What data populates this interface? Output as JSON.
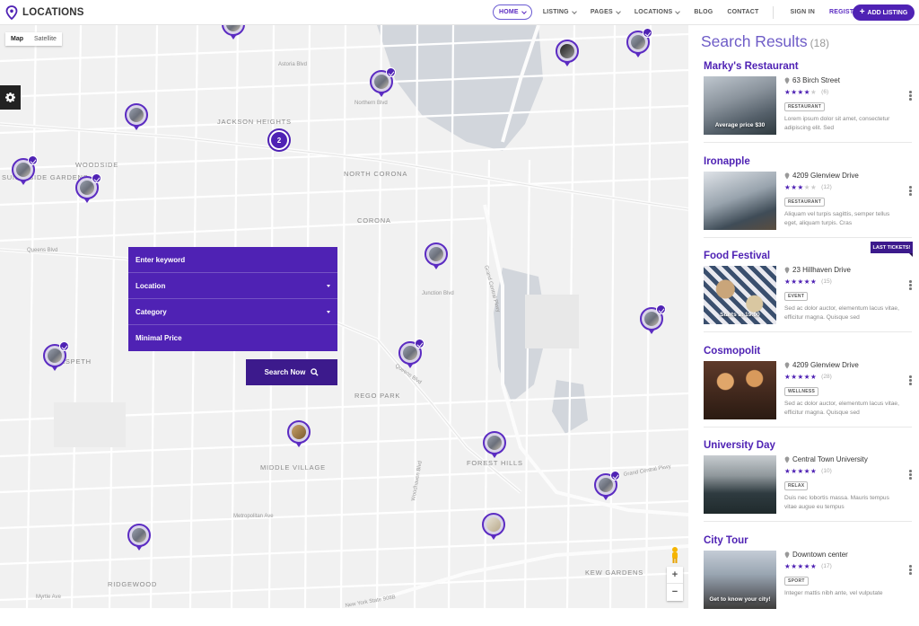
{
  "header": {
    "logo_text": "LOCATIONS",
    "nav": [
      {
        "label": "HOME",
        "dropdown": true,
        "active": true
      },
      {
        "label": "LISTING",
        "dropdown": true
      },
      {
        "label": "PAGES",
        "dropdown": true
      },
      {
        "label": "LOCATIONS",
        "dropdown": true
      },
      {
        "label": "BLOG",
        "dropdown": false
      },
      {
        "label": "CONTACT",
        "dropdown": false
      }
    ],
    "sign_in": "SIGN IN",
    "register": "REGISTER",
    "add_listing": "ADD LISTING",
    "accent_color": "#4f22b4"
  },
  "map": {
    "type_options": [
      "Map",
      "Satellite"
    ],
    "selected_type": "Map",
    "cluster_count": "2",
    "area_labels": [
      "JACKSON HEIGHTS",
      "WOODSIDE",
      "SUNNYSIDE GARDENS",
      "NORTH CORONA",
      "CORONA",
      "MASPETH",
      "REGO PARK",
      "MIDDLE VILLAGE",
      "FOREST HILLS",
      "RIDGEWOOD",
      "KEW GARDENS"
    ],
    "street_labels": [
      "Queens Blvd",
      "Northern Blvd",
      "Grand Central Pkwy",
      "Astoria Blvd",
      "Junction Blvd",
      "Woodhaven Blvd",
      "Metropolitan Ave",
      "Myrtle Ave",
      "Queens Blvd",
      "New York State 908B",
      "Grand Central Pkwy"
    ],
    "zoom_in": "+",
    "zoom_out": "−"
  },
  "search_panel": {
    "keyword_placeholder": "Enter keyword",
    "location_label": "Location",
    "category_label": "Category",
    "price_label": "Minimal Price",
    "search_button": "Search Now"
  },
  "results": {
    "title": "Search Results",
    "count": "(18)",
    "badge": "LAST TICKETS!",
    "items": [
      {
        "name": "Marky's Restaurant",
        "address": "63 Birch Street",
        "stars": 4,
        "reviews": "(6)",
        "tag": "RESTAURANT",
        "caption": "Average price $30",
        "description": "Lorem ipsum dolor sit amet, consectetur adipiscing elit. Sed"
      },
      {
        "name": "Ironapple",
        "address": "4209 Glenview Drive",
        "stars": 3,
        "reviews": "(12)",
        "tag": "RESTAURANT",
        "caption": "",
        "description": "Aliquam vel turpis sagittis, semper tellus eget, aliquam turpis. Cras"
      },
      {
        "name": "Food Festival",
        "address": "23 Hillhaven Drive",
        "stars": 5,
        "reviews": "(15)",
        "tag": "EVENT",
        "caption": "Starts at 19:00",
        "description": "Sed ac dolor auctor, elementum lacus vitae, efficitur magna. Quisque sed"
      },
      {
        "name": "Cosmopolit",
        "address": "4209 Glenview Drive",
        "stars": 5,
        "reviews": "(28)",
        "tag": "WELLNESS",
        "caption": "",
        "description": "Sed ac dolor auctor, elementum lacus vitae, efficitur magna. Quisque sed"
      },
      {
        "name": "University Day",
        "address": "Central Town University",
        "stars": 5,
        "reviews": "(10)",
        "tag": "RELAX",
        "caption": "",
        "description": "Duis nec lobortis massa. Mauris tempus vitae augue eu tempus"
      },
      {
        "name": "City Tour",
        "address": "Downtown center",
        "stars": 5,
        "reviews": "(17)",
        "tag": "SPORT",
        "caption": "Get to know your city!",
        "description": "Integer mattis nibh ante, vel vulputate"
      }
    ]
  }
}
